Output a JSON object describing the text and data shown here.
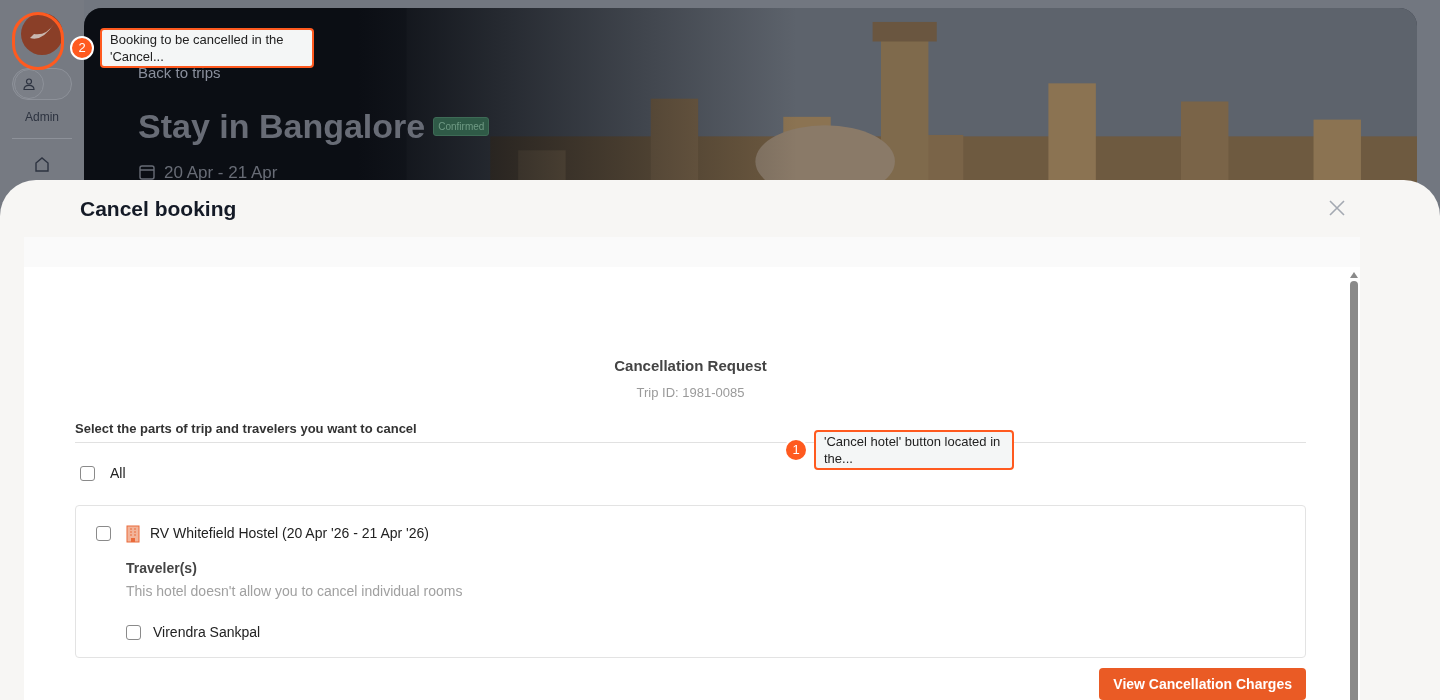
{
  "sidebar": {
    "user_label": "Admin",
    "role_toggle": {
      "on": false
    }
  },
  "hero": {
    "back_link": "Back to trips",
    "title": "Stay in Bangalore",
    "status": "Confirmed",
    "dates": "20 Apr - 21 Apr"
  },
  "modal": {
    "title": "Cancel booking",
    "heading": "Cancellation Request",
    "trip_id": "Trip ID: 1981-0085",
    "instruction": "Select the parts of trip and travelers you want to cancel",
    "select_all": {
      "label": "All",
      "checked": false
    },
    "bookings": [
      {
        "name": "RV Whitefield Hostel (20 Apr '26 - 21 Apr '26)",
        "checked": false,
        "travelers_heading": "Traveler(s)",
        "note": "This hotel doesn't allow you to cancel individual rooms",
        "travelers": [
          {
            "name": "Virendra Sankpal",
            "checked": false
          }
        ]
      }
    ],
    "action": "View Cancellation Charges"
  },
  "callouts": [
    {
      "number": "2",
      "text": "Booking to be cancelled in the 'Cancel..."
    },
    {
      "number": "1",
      "text": "'Cancel hotel' button located in the..."
    }
  ]
}
